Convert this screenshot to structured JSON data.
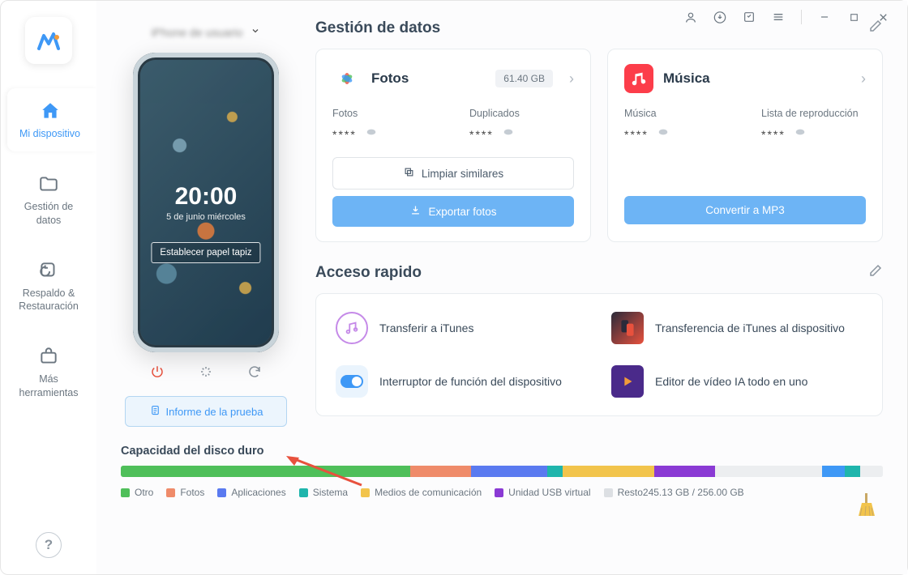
{
  "sidebar": {
    "items": [
      {
        "label": "Mi dispositivo"
      },
      {
        "label": "Gestión de datos"
      },
      {
        "label": "Respaldo & Restauración"
      },
      {
        "label": "Más herramientas"
      }
    ]
  },
  "device": {
    "time": "20:00",
    "date": "5 de junio miércoles",
    "wallpaper_btn": "Establecer papel tapiz",
    "report_btn": "Informe de la prueba"
  },
  "data_mgmt": {
    "title": "Gestión de datos",
    "photos": {
      "title": "Fotos",
      "size": "61.40 GB",
      "photos_label": "Fotos",
      "dup_label": "Duplicados",
      "masked": "****",
      "clean_btn": "Limpiar similares",
      "export_btn": "Exportar fotos"
    },
    "music": {
      "title": "Música",
      "music_label": "Música",
      "playlist_label": "Lista de reproducción",
      "masked": "****",
      "convert_btn": "Convertir a MP3"
    }
  },
  "quick": {
    "title": "Acceso rapido",
    "items": [
      {
        "label": "Transferir a iTunes"
      },
      {
        "label": "Transferencia de iTunes al dispositivo"
      },
      {
        "label": "Interruptor de función del dispositivo"
      },
      {
        "label": "Editor de vídeo IA todo en uno"
      }
    ]
  },
  "storage": {
    "title": "Capacidad del disco duro",
    "segments": [
      {
        "name": "Otro",
        "color": "#4fbf5a",
        "pct": 38
      },
      {
        "name": "Fotos",
        "color": "#ef8b6a",
        "pct": 8
      },
      {
        "name": "Aplicaciones",
        "color": "#5a7af0",
        "pct": 10
      },
      {
        "name": "Sistema",
        "color": "#1fb5ac",
        "pct": 2
      },
      {
        "name": "Medios de comunicación",
        "color": "#f2c44c",
        "pct": 12
      },
      {
        "name": "Unidad USB virtual",
        "color": "#8a3ad4",
        "pct": 8
      },
      {
        "name": "gap",
        "color": "#eceef0",
        "pct": 14
      },
      {
        "name": "tail1",
        "color": "#3e98f6",
        "pct": 3
      },
      {
        "name": "tail2",
        "color": "#1fb5ac",
        "pct": 2
      },
      {
        "name": "tail3",
        "color": "#eceef0",
        "pct": 3
      }
    ],
    "legend": [
      {
        "name": "Otro",
        "color": "#4fbf5a"
      },
      {
        "name": "Fotos",
        "color": "#ef8b6a"
      },
      {
        "name": "Aplicaciones",
        "color": "#5a7af0"
      },
      {
        "name": "Sistema",
        "color": "#1fb5ac"
      },
      {
        "name": "Medios de comunicación",
        "color": "#f2c44c"
      },
      {
        "name": "Unidad USB virtual",
        "color": "#8a3ad4"
      }
    ],
    "rest_label": "Resto245.13 GB / 256.00 GB"
  }
}
